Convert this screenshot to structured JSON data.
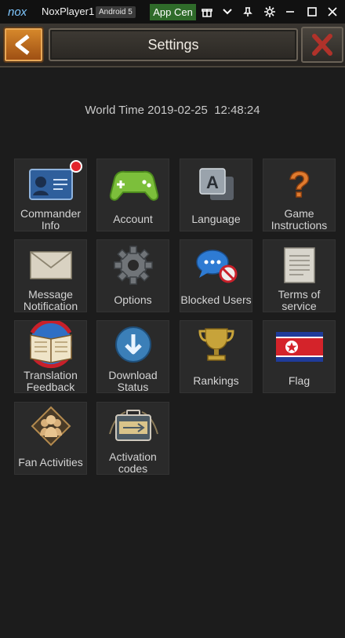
{
  "emulator": {
    "title": "NoxPlayer1 6...",
    "android_badge": "Android 5",
    "app_center": "App Cen"
  },
  "header": {
    "title": "Settings"
  },
  "world_time": {
    "label": "World Time",
    "date": "2019-02-25",
    "time": "12:48:24"
  },
  "tiles": [
    {
      "line1": "Commander",
      "line2": "Info",
      "icon": "commander-id-card-icon",
      "badge": true
    },
    {
      "line1": "Account",
      "line2": "",
      "icon": "gamepad-icon",
      "badge": false
    },
    {
      "line1": "Language",
      "line2": "",
      "icon": "language-a-icon",
      "badge": false
    },
    {
      "line1": "Game",
      "line2": "Instructions",
      "icon": "question-mark-icon",
      "badge": false
    },
    {
      "line1": "Message",
      "line2": "Notification",
      "icon": "envelope-icon",
      "badge": false
    },
    {
      "line1": "Options",
      "line2": "",
      "icon": "gear-icon",
      "badge": false
    },
    {
      "line1": "Blocked Users",
      "line2": "",
      "icon": "blocked-chat-icon",
      "badge": false
    },
    {
      "line1": "Terms of",
      "line2": "service",
      "icon": "document-icon",
      "badge": false
    },
    {
      "line1": "Translation",
      "line2": "Feedback",
      "icon": "book-globe-icon",
      "badge": false
    },
    {
      "line1": "Download",
      "line2": "Status",
      "icon": "download-arrow-icon",
      "badge": false
    },
    {
      "line1": "Rankings",
      "line2": "",
      "icon": "trophy-icon",
      "badge": false
    },
    {
      "line1": "Flag",
      "line2": "",
      "icon": "flag-icon",
      "badge": false
    },
    {
      "line1": "Fan Activities",
      "line2": "",
      "icon": "fan-group-icon",
      "badge": false
    },
    {
      "line1": "Activation",
      "line2": "codes",
      "icon": "gift-briefcase-icon",
      "badge": false
    }
  ],
  "colors": {
    "background": "#1c1c1c",
    "tile": "#2a2a2a",
    "accent_orange": "#c9762a",
    "badge_red": "#e3242b"
  }
}
